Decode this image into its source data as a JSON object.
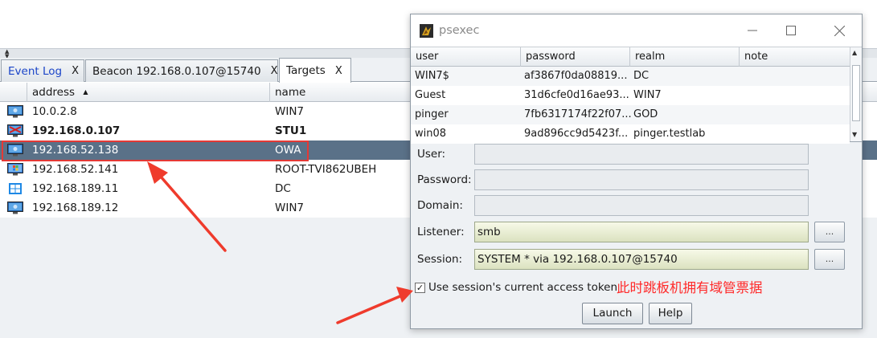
{
  "tabs": [
    {
      "label": "Event Log",
      "close": "X"
    },
    {
      "label": "Beacon 192.168.0.107@15740",
      "close": "X"
    },
    {
      "label": "Targets",
      "close": "X"
    }
  ],
  "targets": {
    "columns": {
      "address": "address",
      "sort_indicator": "▲",
      "name": "name"
    },
    "rows": [
      {
        "address": "10.0.2.8",
        "name": "WIN7",
        "icon": "windows7-monitor-icon",
        "bold": false,
        "selected": false
      },
      {
        "address": "192.168.0.107",
        "name": "STU1",
        "icon": "compromised-monitor-icon",
        "bold": true,
        "selected": false
      },
      {
        "address": "192.168.52.138",
        "name": "OWA",
        "icon": "windows7-monitor-icon",
        "bold": false,
        "selected": true
      },
      {
        "address": "192.168.52.141",
        "name": "ROOT-TVI862UBEH",
        "icon": "windows-xp-monitor-icon",
        "bold": false,
        "selected": false
      },
      {
        "address": "192.168.189.11",
        "name": "DC",
        "icon": "windows10-logo-icon",
        "bold": false,
        "selected": false
      },
      {
        "address": "192.168.189.12",
        "name": "WIN7",
        "icon": "windows7-monitor-icon",
        "bold": false,
        "selected": false
      }
    ]
  },
  "dialog": {
    "title": "psexec",
    "credentials": {
      "columns": [
        "user",
        "password",
        "realm",
        "note"
      ],
      "rows": [
        {
          "user": "WIN7$",
          "password": "af3867f0da08819...",
          "realm": "DC",
          "note": ""
        },
        {
          "user": "Guest",
          "password": "31d6cfe0d16ae93...",
          "realm": "WIN7",
          "note": ""
        },
        {
          "user": "pinger",
          "password": "7fb6317174f22f07...",
          "realm": "GOD",
          "note": ""
        },
        {
          "user": "win08",
          "password": "9ad896cc9d5423f...",
          "realm": "pinger.testlab",
          "note": ""
        }
      ]
    },
    "form": {
      "user_label": "User:",
      "user_value": "",
      "password_label": "Password:",
      "password_value": "",
      "domain_label": "Domain:",
      "domain_value": "",
      "listener_label": "Listener:",
      "listener_value": "smb",
      "session_label": "Session:",
      "session_value": "SYSTEM * via  192.168.0.107@15740",
      "browse_label": "..."
    },
    "use_token": {
      "checked": true,
      "mark": "✓",
      "label": "Use session's current access token"
    },
    "annotation": "此时跳板机拥有域管票据",
    "buttons": {
      "launch": "Launch",
      "help": "Help"
    }
  },
  "colors": {
    "selection": "#5a7188",
    "annotation_red": "#e53935",
    "tab_blue": "#1b45c8"
  }
}
